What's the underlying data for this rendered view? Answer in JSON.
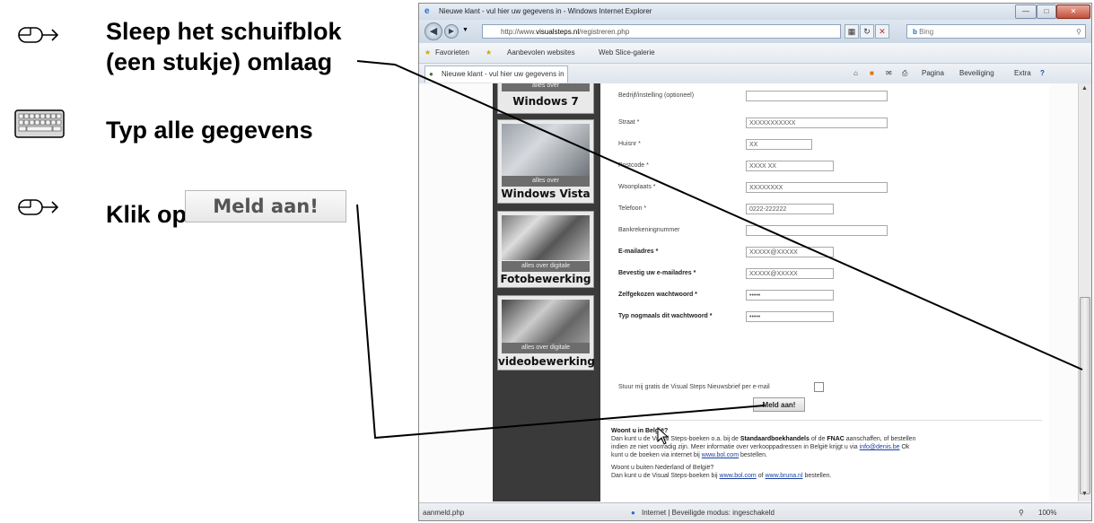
{
  "instructions": {
    "step1_line1": "Sleep het schuifblok",
    "step1_line2": "(een stukje) omlaag",
    "step2": "Typ alle gegevens",
    "step3": "Klik op",
    "step3_button": "Meld aan!"
  },
  "browser": {
    "title": "Nieuwe klant - vul hier uw gegevens in - Windows Internet Explorer",
    "url_prefix": "http://www.",
    "url_domain": "visualsteps.nl",
    "url_path": "/registreren.php",
    "search_placeholder": "Bing",
    "favorites_label": "Favorieten",
    "suggested_sites": "Aanbevolen websites",
    "web_slice": "Web Slice-galerie",
    "tab_title": "Nieuwe klant - vul hier uw gegevens in",
    "cmd_pagina": "Pagina",
    "cmd_beveiliging": "Beveiliging",
    "cmd_extra": "Extra",
    "status_url": "aanmeld.php",
    "status_zone": "Internet | Beveiligde modus: ingeschakeld",
    "zoom": "100%"
  },
  "sidebar_books": [
    {
      "band": "alles over",
      "name": "Windows 7"
    },
    {
      "band": "alles over",
      "name": "Windows Vista"
    },
    {
      "band": "alles over digitale",
      "name": "Fotobewerking"
    },
    {
      "band": "alles over digitale",
      "name": "videobewerking"
    }
  ],
  "form": {
    "rows": [
      {
        "label": "Bedrijf/instelling (optioneel)",
        "value": ""
      },
      {
        "label": "Straat *",
        "value": "XXXXXXXXXXX"
      },
      {
        "label": "Huisnr *",
        "value": "XX"
      },
      {
        "label": "Postcode *",
        "value": "XXXX XX"
      },
      {
        "label": "Woonplaats *",
        "value": "XXXXXXXX"
      },
      {
        "label": "Telefoon *",
        "value": "0222-222222"
      },
      {
        "label": "Bankrekeningnummer",
        "value": ""
      },
      {
        "label": "E-mailadres *",
        "value": "XXXXX@XXXXX"
      },
      {
        "label": "Bevestig uw e-mailadres *",
        "value": "XXXXX@XXXXX"
      },
      {
        "label": "Zelfgekozen wachtwoord *",
        "value": "•••••"
      },
      {
        "label": "Typ nogmaals dit wachtwoord *",
        "value": "•••••"
      }
    ],
    "newsletter_label": "Stuur mij gratis de Visual Steps Nieuwsbrief per e-mail",
    "newsletter_checked": false,
    "submit_label": "Meld aan!"
  },
  "belgium_info": {
    "heading": "Woont u in België?",
    "line1_a": "Dan kunt u de Visual Steps-boeken o.a. bij de ",
    "line1_b": "Standaardboekhandels",
    "line1_c": " of de ",
    "line1_d": "FNAC",
    "line1_e": " aanschaffen, of bestellen",
    "line2_a": "indien ze niet voorradig zijn. Meer informatie over verkooppadressen in België krijgt u via ",
    "line2_link": "info@denis.be",
    "line2_b": " Ok",
    "line3_a": "kunt u de boeken via internet bij ",
    "line3_link": "www.bol.com",
    "line3_b": " bestellen.",
    "outside_heading": "Woont u buiten Nederland of België?",
    "outside_a": "Dan kunt u de Visual Steps-boeken bij ",
    "outside_link1": "www.bol.com",
    "outside_mid": " of ",
    "outside_link2": "www.bruna.nl",
    "outside_b": " bestellen."
  },
  "colors": {
    "sidebar_bg": "#3a3a3a",
    "pointer_line": "#000000"
  }
}
